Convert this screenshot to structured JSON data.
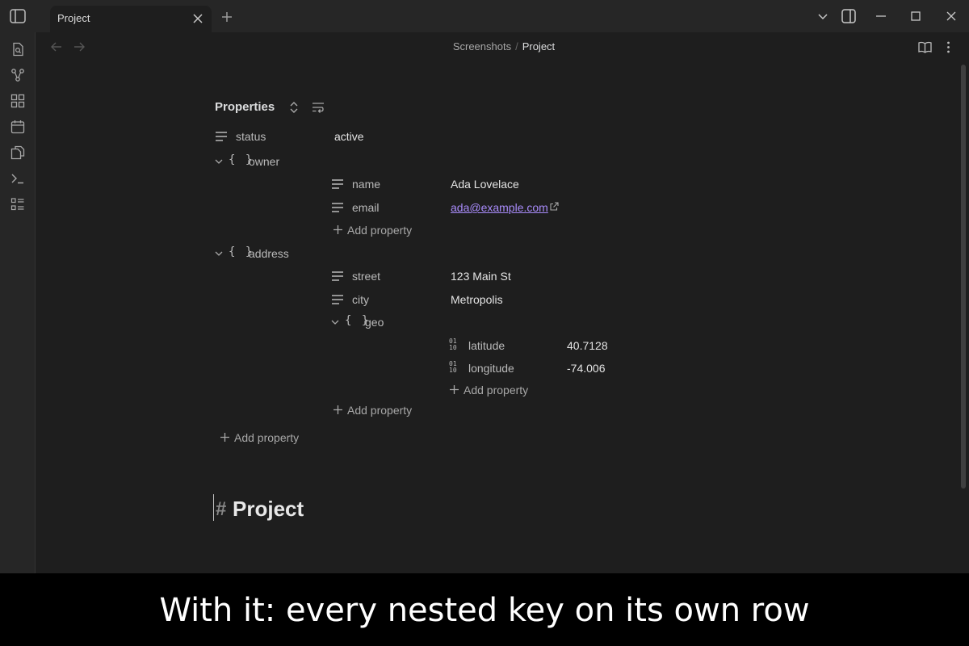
{
  "tab": {
    "label": "Project"
  },
  "breadcrumb": {
    "parent": "Screenshots",
    "separator": "/",
    "current": "Project"
  },
  "properties": {
    "heading": "Properties",
    "status": {
      "key": "status",
      "value": "active"
    },
    "owner": {
      "key": "owner",
      "braces": "{ }",
      "name": {
        "key": "name",
        "value": "Ada Lovelace"
      },
      "email": {
        "key": "email",
        "value": "ada@example.com"
      },
      "add_label": "Add property"
    },
    "address": {
      "key": "address",
      "braces": "{ }",
      "street": {
        "key": "street",
        "value": "123 Main St"
      },
      "city": {
        "key": "city",
        "value": "Metropolis"
      },
      "geo": {
        "key": "geo",
        "braces": "{ }",
        "latitude": {
          "key": "latitude",
          "value": "40.7128"
        },
        "longitude": {
          "key": "longitude",
          "value": "-74.006"
        },
        "add_label": "Add property"
      },
      "add_label": "Add property"
    },
    "add_label": "Add property"
  },
  "number_icon": {
    "top": "01",
    "bottom": "10"
  },
  "document": {
    "hash": "#",
    "title": "Project"
  },
  "caption": {
    "text": "With it: every nested key on its own row"
  },
  "colors": {
    "background": "#1e1e1e",
    "chrome": "#262626",
    "link": "#a88bfa",
    "caption_bg": "#000000"
  }
}
